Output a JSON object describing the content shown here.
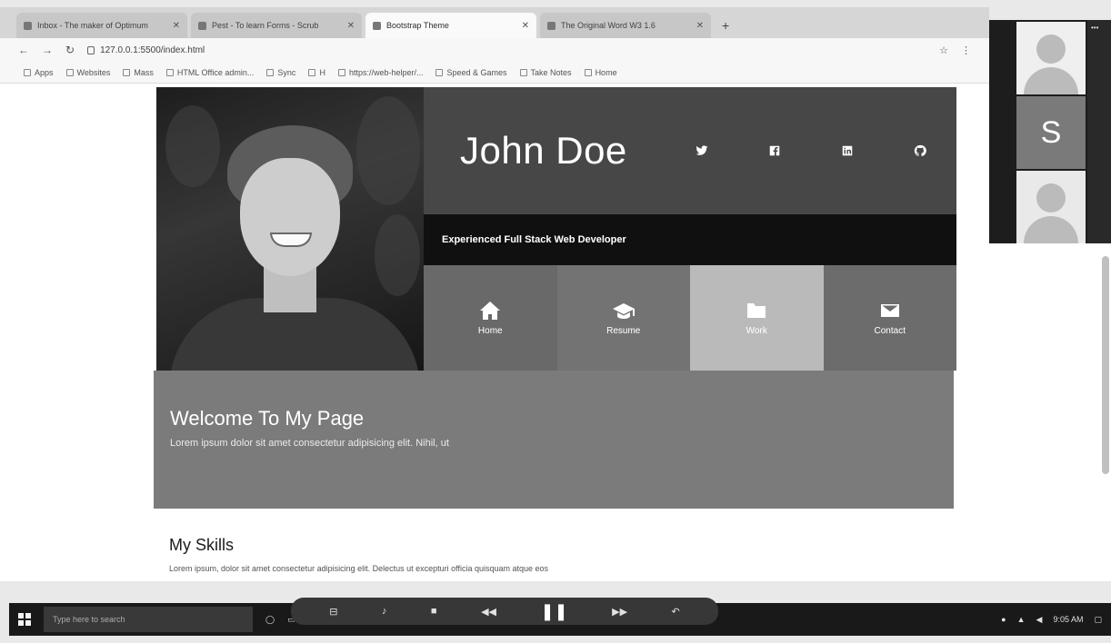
{
  "browser": {
    "tabs": [
      {
        "title": "Inbox - The maker of Optimum"
      },
      {
        "title": "Pest - To learn Forms - Scrub"
      },
      {
        "title": "Bootstrap Theme"
      },
      {
        "title": "The Original Word W3 1.6"
      }
    ],
    "url": "127.0.0.1:5500/index.html",
    "bookmarks": [
      "Apps",
      "Websites",
      "Mass",
      "HTML Office admin...",
      "Sync",
      "H",
      "https://web-helper/...",
      "Speed & Games",
      "Take Notes",
      "Home"
    ]
  },
  "hero": {
    "name": "John Doe",
    "subtitle": "Experienced Full Stack Web Developer",
    "social_icons": [
      "twitter-icon",
      "facebook-icon",
      "linkedin-icon",
      "github-icon"
    ]
  },
  "menu": [
    {
      "label": "Home",
      "icon": "home-icon"
    },
    {
      "label": "Resume",
      "icon": "graduation-cap-icon"
    },
    {
      "label": "Work",
      "icon": "folder-icon"
    },
    {
      "label": "Contact",
      "icon": "envelope-icon"
    }
  ],
  "welcome": {
    "title": "Welcome To My Page",
    "text": "Lorem ipsum dolor sit amet consectetur adipisicing elit. Nihil, ut"
  },
  "skills": {
    "title": "My Skills",
    "text": "Lorem ipsum, dolor sit amet consectetur adipisicing elit. Delectus ut excepturi officia quisquam atque eos"
  },
  "participants": [
    {
      "type": "avatar"
    },
    {
      "type": "initial",
      "initial": "S"
    },
    {
      "type": "avatar"
    }
  ],
  "taskbar": {
    "search_placeholder": "Type here to search",
    "time": "9:05 AM"
  }
}
